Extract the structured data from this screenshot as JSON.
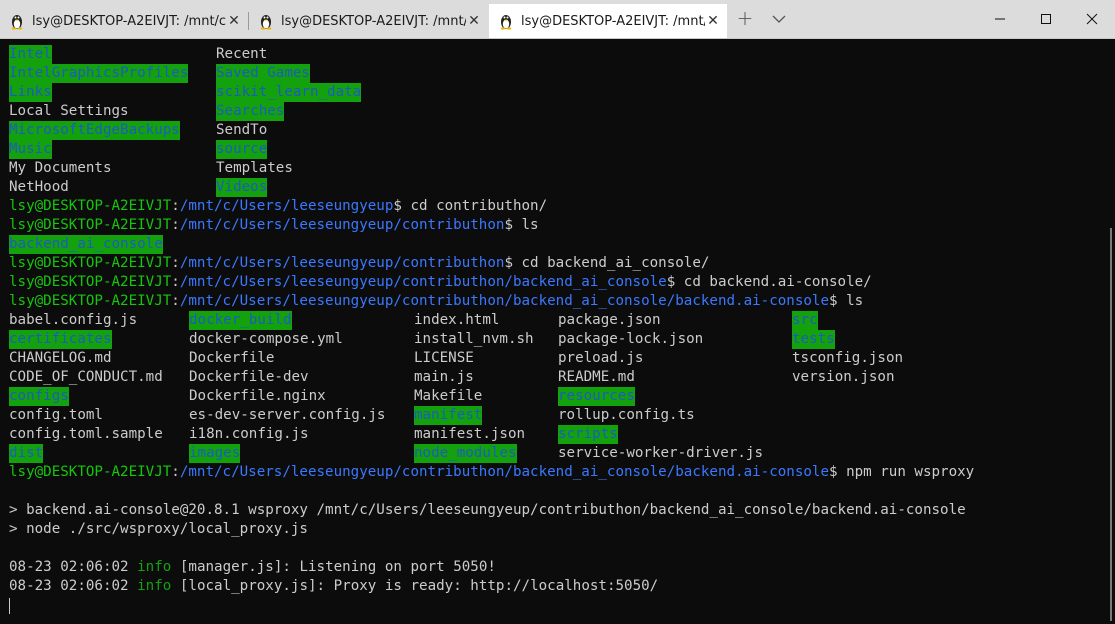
{
  "tabs": [
    {
      "title": "lsy@DESKTOP-A2EIVJT: /mnt/c",
      "close": "✕"
    },
    {
      "title": "lsy@DESKTOP-A2EIVJT: /mnt/c",
      "close": "✕"
    },
    {
      "title": "lsy@DESKTOP-A2EIVJT: /mnt/c",
      "close": "✕"
    }
  ],
  "new_tab": "+",
  "prompt": {
    "user": "lsy@DESKTOP-A2EIVJT",
    "colon": ":"
  },
  "home_listing": [
    [
      "Intel",
      "Recent"
    ],
    [
      "IntelGraphicsProfiles",
      "Saved Games"
    ],
    [
      "Links",
      "scikit_learn_data"
    ],
    [
      "Local Settings",
      "Searches"
    ],
    [
      "MicrosoftEdgeBackups",
      "SendTo"
    ],
    [
      "Music",
      "source"
    ],
    [
      "My Documents",
      "Templates"
    ],
    [
      "NetHood",
      "Videos"
    ]
  ],
  "commands": [
    {
      "path": "/mnt/c/Users/leeseungyeup",
      "cmd": "$ cd contributhon/"
    },
    {
      "path": "/mnt/c/Users/leeseungyeup/contributhon",
      "cmd": "$ ls"
    },
    {
      "out": "backend_ai_console"
    },
    {
      "path": "/mnt/c/Users/leeseungyeup/contributhon",
      "cmd": "$ cd backend_ai_console/"
    },
    {
      "path": "/mnt/c/Users/leeseungyeup/contributhon/backend_ai_console",
      "cmd": "$ cd backend.ai-console/"
    },
    {
      "path": "/mnt/c/Users/leeseungyeup/contributhon/backend_ai_console/backend.ai-console",
      "cmd": "$ ls"
    }
  ],
  "ls_listing": [
    [
      "babel.config.js",
      "docker_build",
      "index.html",
      "package.json",
      "src"
    ],
    [
      "certificates",
      "docker-compose.yml",
      "install_nvm.sh",
      "package-lock.json",
      "tests"
    ],
    [
      "CHANGELOG.md",
      "Dockerfile",
      "LICENSE",
      "preload.js",
      "tsconfig.json"
    ],
    [
      "CODE_OF_CONDUCT.md",
      "Dockerfile-dev",
      "main.js",
      "README.md",
      "version.json"
    ],
    [
      "configs",
      "Dockerfile.nginx",
      "Makefile",
      "resources",
      ""
    ],
    [
      "config.toml",
      "es-dev-server.config.js",
      "manifest",
      "rollup.config.ts",
      ""
    ],
    [
      "config.toml.sample",
      "i18n.config.js",
      "manifest.json",
      "scripts",
      ""
    ],
    [
      "dist",
      "images",
      "node_modules",
      "service-worker-driver.js",
      ""
    ]
  ],
  "last_prompt": {
    "path": "/mnt/c/Users/leeseungyeup/contributhon/backend_ai_console/backend.ai-console",
    "cmd": "$ npm run wsproxy"
  },
  "npm_output": [
    "> backend.ai-console@20.8.1 wsproxy /mnt/c/Users/leeseungyeup/contributhon/backend_ai_console/backend.ai-console",
    "> node ./src/wsproxy/local_proxy.js"
  ],
  "logs": [
    {
      "ts": "08-23 02:06:02",
      "level": "info",
      "msg": "[manager.js]: Listening on port 5050!"
    },
    {
      "ts": "08-23 02:06:02",
      "level": "info",
      "msg": "[local_proxy.js]: Proxy is ready: http://localhost:5050/"
    }
  ],
  "colors": {
    "dir_bg": "#13a10e",
    "dir_fg": "#1e5bbf",
    "user": "#16c60c",
    "path": "#3b78ff",
    "text": "#cccccc",
    "bg": "#0c0c0c"
  }
}
